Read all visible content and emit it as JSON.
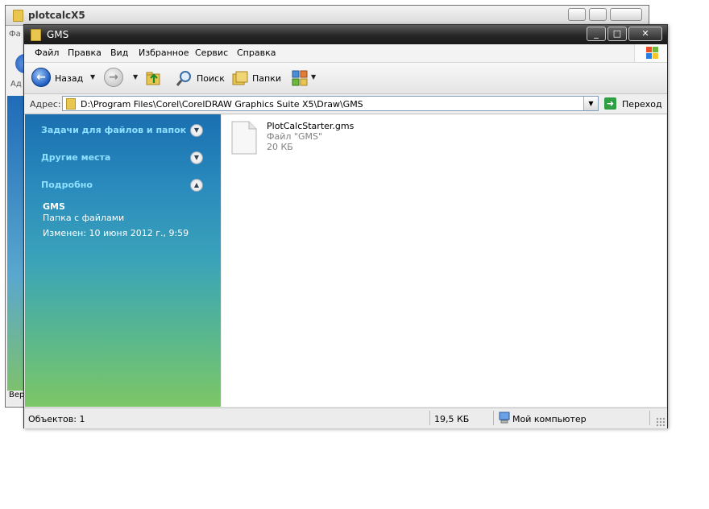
{
  "background_window": {
    "title": "plotcalcX5",
    "status_fragment": "Вер",
    "menu_fragment": "Фа",
    "addr_fragment": "Ад"
  },
  "window": {
    "title": "GMS",
    "controls": {
      "minimize": "_",
      "maximize": "□",
      "close": "✕"
    }
  },
  "menu": [
    "Файл",
    "Правка",
    "Вид",
    "Избранное",
    "Сервис",
    "Справка"
  ],
  "toolbar": {
    "back_label": "Назад",
    "search_label": "Поиск",
    "folders_label": "Папки"
  },
  "address": {
    "label": "Адрес:",
    "value": "D:\\Program Files\\Corel\\CorelDRAW Graphics Suite X5\\Draw\\GMS",
    "go_label": "Переход"
  },
  "tasks": {
    "sections": [
      {
        "title": "Задачи для файлов и папок",
        "state": "collapsed"
      },
      {
        "title": "Другие места",
        "state": "collapsed"
      },
      {
        "title": "Подробно",
        "state": "expanded"
      }
    ],
    "details": {
      "name": "GMS",
      "type": "Папка с файлами",
      "modified": "Изменен: 10 июня 2012 г., 9:59"
    }
  },
  "files": [
    {
      "name": "PlotCalcStarter.gms",
      "type": "Файл \"GMS\"",
      "size": "20 КБ"
    }
  ],
  "status": {
    "objects": "Объектов: 1",
    "size": "19,5 КБ",
    "location": "Мой компьютер"
  },
  "colors": {
    "titlebar": "#262626",
    "pane_top": "#1a6fb0",
    "pane_bottom": "#7cc665",
    "pane_heading": "#8ee0ff"
  }
}
